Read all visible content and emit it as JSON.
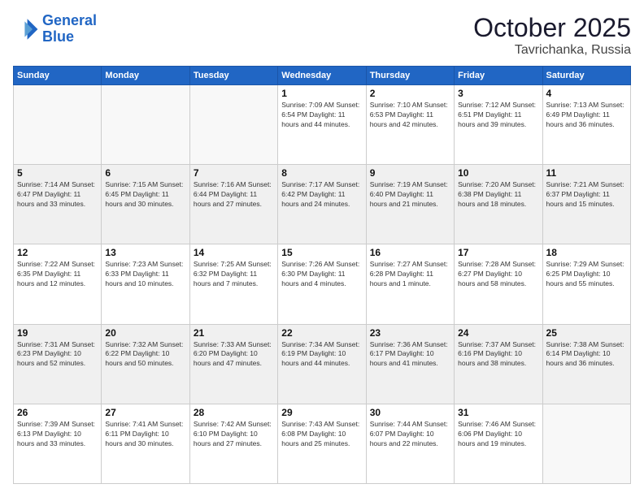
{
  "header": {
    "logo_line1": "General",
    "logo_line2": "Blue",
    "month": "October 2025",
    "location": "Tavrichanka, Russia"
  },
  "weekdays": [
    "Sunday",
    "Monday",
    "Tuesday",
    "Wednesday",
    "Thursday",
    "Friday",
    "Saturday"
  ],
  "weeks": [
    [
      {
        "day": "",
        "info": ""
      },
      {
        "day": "",
        "info": ""
      },
      {
        "day": "",
        "info": ""
      },
      {
        "day": "1",
        "info": "Sunrise: 7:09 AM\nSunset: 6:54 PM\nDaylight: 11 hours and 44 minutes."
      },
      {
        "day": "2",
        "info": "Sunrise: 7:10 AM\nSunset: 6:53 PM\nDaylight: 11 hours and 42 minutes."
      },
      {
        "day": "3",
        "info": "Sunrise: 7:12 AM\nSunset: 6:51 PM\nDaylight: 11 hours and 39 minutes."
      },
      {
        "day": "4",
        "info": "Sunrise: 7:13 AM\nSunset: 6:49 PM\nDaylight: 11 hours and 36 minutes."
      }
    ],
    [
      {
        "day": "5",
        "info": "Sunrise: 7:14 AM\nSunset: 6:47 PM\nDaylight: 11 hours and 33 minutes."
      },
      {
        "day": "6",
        "info": "Sunrise: 7:15 AM\nSunset: 6:45 PM\nDaylight: 11 hours and 30 minutes."
      },
      {
        "day": "7",
        "info": "Sunrise: 7:16 AM\nSunset: 6:44 PM\nDaylight: 11 hours and 27 minutes."
      },
      {
        "day": "8",
        "info": "Sunrise: 7:17 AM\nSunset: 6:42 PM\nDaylight: 11 hours and 24 minutes."
      },
      {
        "day": "9",
        "info": "Sunrise: 7:19 AM\nSunset: 6:40 PM\nDaylight: 11 hours and 21 minutes."
      },
      {
        "day": "10",
        "info": "Sunrise: 7:20 AM\nSunset: 6:38 PM\nDaylight: 11 hours and 18 minutes."
      },
      {
        "day": "11",
        "info": "Sunrise: 7:21 AM\nSunset: 6:37 PM\nDaylight: 11 hours and 15 minutes."
      }
    ],
    [
      {
        "day": "12",
        "info": "Sunrise: 7:22 AM\nSunset: 6:35 PM\nDaylight: 11 hours and 12 minutes."
      },
      {
        "day": "13",
        "info": "Sunrise: 7:23 AM\nSunset: 6:33 PM\nDaylight: 11 hours and 10 minutes."
      },
      {
        "day": "14",
        "info": "Sunrise: 7:25 AM\nSunset: 6:32 PM\nDaylight: 11 hours and 7 minutes."
      },
      {
        "day": "15",
        "info": "Sunrise: 7:26 AM\nSunset: 6:30 PM\nDaylight: 11 hours and 4 minutes."
      },
      {
        "day": "16",
        "info": "Sunrise: 7:27 AM\nSunset: 6:28 PM\nDaylight: 11 hours and 1 minute."
      },
      {
        "day": "17",
        "info": "Sunrise: 7:28 AM\nSunset: 6:27 PM\nDaylight: 10 hours and 58 minutes."
      },
      {
        "day": "18",
        "info": "Sunrise: 7:29 AM\nSunset: 6:25 PM\nDaylight: 10 hours and 55 minutes."
      }
    ],
    [
      {
        "day": "19",
        "info": "Sunrise: 7:31 AM\nSunset: 6:23 PM\nDaylight: 10 hours and 52 minutes."
      },
      {
        "day": "20",
        "info": "Sunrise: 7:32 AM\nSunset: 6:22 PM\nDaylight: 10 hours and 50 minutes."
      },
      {
        "day": "21",
        "info": "Sunrise: 7:33 AM\nSunset: 6:20 PM\nDaylight: 10 hours and 47 minutes."
      },
      {
        "day": "22",
        "info": "Sunrise: 7:34 AM\nSunset: 6:19 PM\nDaylight: 10 hours and 44 minutes."
      },
      {
        "day": "23",
        "info": "Sunrise: 7:36 AM\nSunset: 6:17 PM\nDaylight: 10 hours and 41 minutes."
      },
      {
        "day": "24",
        "info": "Sunrise: 7:37 AM\nSunset: 6:16 PM\nDaylight: 10 hours and 38 minutes."
      },
      {
        "day": "25",
        "info": "Sunrise: 7:38 AM\nSunset: 6:14 PM\nDaylight: 10 hours and 36 minutes."
      }
    ],
    [
      {
        "day": "26",
        "info": "Sunrise: 7:39 AM\nSunset: 6:13 PM\nDaylight: 10 hours and 33 minutes."
      },
      {
        "day": "27",
        "info": "Sunrise: 7:41 AM\nSunset: 6:11 PM\nDaylight: 10 hours and 30 minutes."
      },
      {
        "day": "28",
        "info": "Sunrise: 7:42 AM\nSunset: 6:10 PM\nDaylight: 10 hours and 27 minutes."
      },
      {
        "day": "29",
        "info": "Sunrise: 7:43 AM\nSunset: 6:08 PM\nDaylight: 10 hours and 25 minutes."
      },
      {
        "day": "30",
        "info": "Sunrise: 7:44 AM\nSunset: 6:07 PM\nDaylight: 10 hours and 22 minutes."
      },
      {
        "day": "31",
        "info": "Sunrise: 7:46 AM\nSunset: 6:06 PM\nDaylight: 10 hours and 19 minutes."
      },
      {
        "day": "",
        "info": ""
      }
    ]
  ]
}
